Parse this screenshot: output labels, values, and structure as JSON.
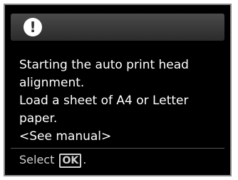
{
  "dialog": {
    "icon": "exclamation-alert-icon",
    "icon_glyph": "!",
    "message_lines": [
      "Starting the auto print head",
      "alignment.",
      "Load a sheet of A4 or Letter",
      "paper.",
      "<See manual>"
    ]
  },
  "footer": {
    "prefix": "Select",
    "key": "OK",
    "suffix": "."
  }
}
